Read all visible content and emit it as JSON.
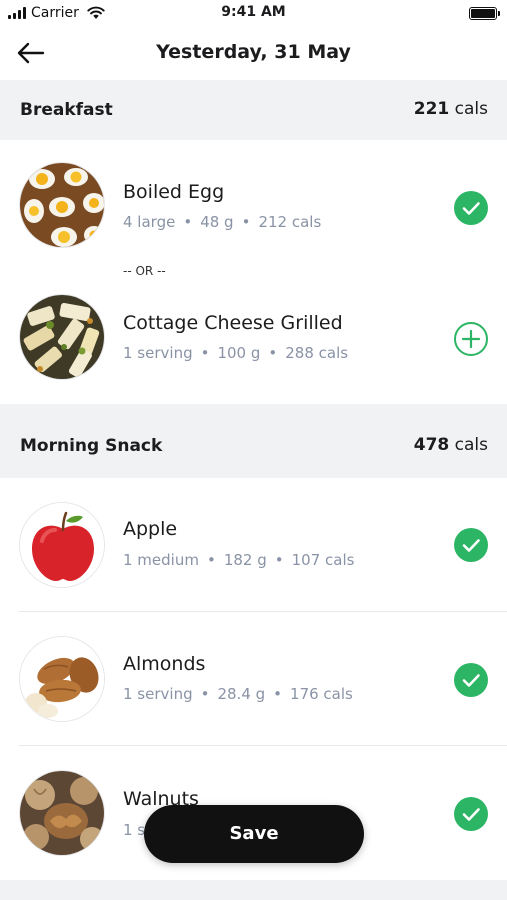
{
  "status_bar": {
    "carrier": "Carrier",
    "time": "9:41 AM"
  },
  "header": {
    "title": "Yesterday, 31 May"
  },
  "sections": [
    {
      "title": "Breakfast",
      "cals_value": "221",
      "cals_unit": "cals",
      "items": [
        {
          "name": "Boiled Egg",
          "qty": "4 large",
          "weight": "48 g",
          "cals": "212 cals",
          "state": "checked"
        },
        {
          "name": "Cottage Cheese Grilled",
          "qty": "1 serving",
          "weight": "100 g",
          "cals": "288 cals",
          "state": "add"
        }
      ],
      "or_label": "-- OR --"
    },
    {
      "title": "Morning Snack",
      "cals_value": "478",
      "cals_unit": "cals",
      "items": [
        {
          "name": "Apple",
          "qty": "1 medium",
          "weight": "182 g",
          "cals": "107 cals",
          "state": "checked"
        },
        {
          "name": "Almonds",
          "qty": "1 serving",
          "weight": "28.4 g",
          "cals": "176 cals",
          "state": "checked"
        },
        {
          "name": "Walnuts",
          "qty": "1 s",
          "weight": "",
          "cals": "",
          "state": "checked"
        }
      ]
    }
  ],
  "meta_separator": "•",
  "save_label": "Save",
  "colors": {
    "accent": "#2bb565",
    "section_bg": "#f1f2f4",
    "meta_text": "#8a93a6"
  }
}
